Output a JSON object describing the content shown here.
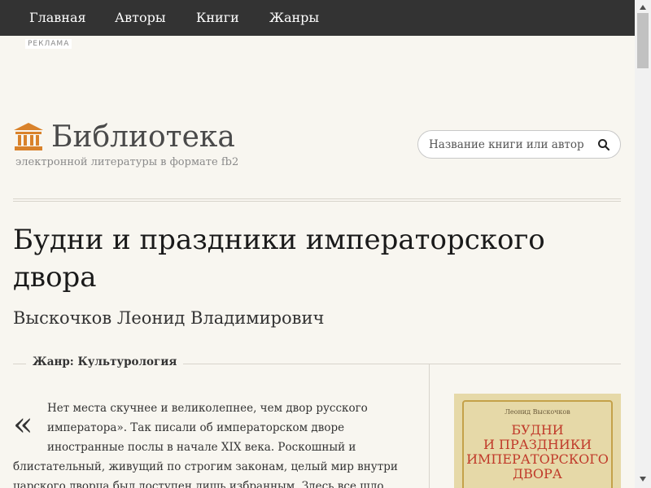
{
  "nav": {
    "items": [
      {
        "label": "Главная"
      },
      {
        "label": "Авторы"
      },
      {
        "label": "Книги"
      },
      {
        "label": "Жанры"
      }
    ]
  },
  "ad": {
    "label": "РЕКЛАМА"
  },
  "brand": {
    "title": "Библиотека",
    "subtitle": "электронной литературы в формате fb2",
    "icon": "library-building-icon",
    "accent_color": "#d9822b"
  },
  "search": {
    "placeholder": "Название книги или автор",
    "value": "",
    "icon": "search-icon"
  },
  "book": {
    "title": "Будни и праздники императорского двора",
    "author": "Выскочков Леонид Владимирович",
    "genre": "Жанр: Культурология",
    "description_lines": [
      "Нет места скучнее и великолепнее, чем двор русского",
      "императора». Так писали об императорском дворе",
      "иностранные послы в начале XIX века. Роскошный и",
      "блистательный, живущий по строгим законам, целый мир внутри",
      "царского дворца был доступен лишь избранным. Здесь все шло"
    ],
    "quote_mark": "«",
    "cover": {
      "author": "Леонид Выскочков",
      "title_lines": [
        "Будни",
        "и праздники",
        "императорского",
        "двора"
      ]
    }
  },
  "colors": {
    "nav_bg": "#333333",
    "page_bg": "#f8f6f0",
    "cover_title": "#c03a2a"
  }
}
